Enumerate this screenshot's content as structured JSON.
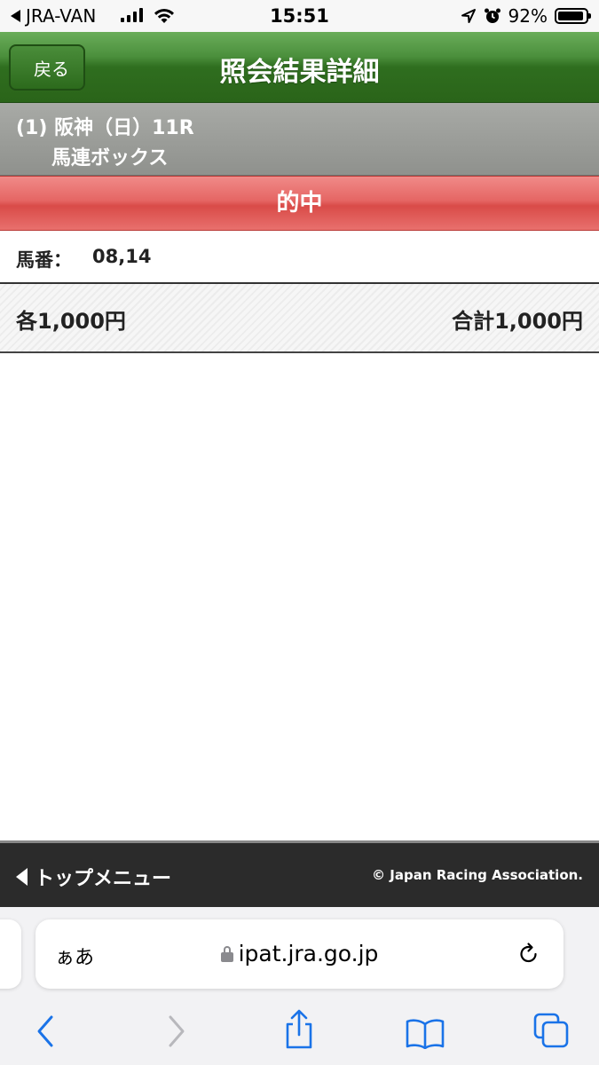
{
  "status_bar": {
    "back_app": "JRA-VAN",
    "time": "15:51",
    "battery": "92%",
    "battery_level": 0.92,
    "icons": [
      "back-arrow-icon",
      "signal-icon",
      "wifi-icon",
      "location-icon",
      "alarm-icon",
      "battery-icon"
    ]
  },
  "header": {
    "back_label": "戻る",
    "title": "照会結果詳細"
  },
  "race": {
    "line1": "(1) 阪神（日）11R",
    "line2": "馬連ボックス"
  },
  "result": {
    "label": "的中"
  },
  "horses": {
    "label": "馬番：",
    "value": "08,14"
  },
  "amount": {
    "each": "各1,000円",
    "total": "合計1,000円"
  },
  "footer": {
    "menu_label": "トップメニュー",
    "copyright": "© Japan Racing Association."
  },
  "browser": {
    "aa_label": "ぁあ",
    "url": "ipat.jra.go.jp",
    "toolbar_icons": [
      "back-icon",
      "forward-icon",
      "share-icon",
      "bookmarks-icon",
      "tabs-icon"
    ]
  },
  "colors": {
    "header_green": "#2f6e1f",
    "race_gray": "#8f918d",
    "hit_red": "#e56664",
    "footer_dark": "#2b2b2b",
    "ios_blue": "#1a73e8"
  }
}
